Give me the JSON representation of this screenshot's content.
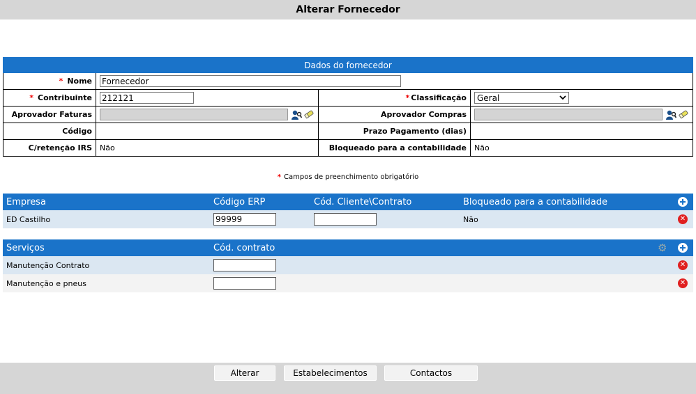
{
  "window": {
    "title": "Alterar Fornecedor"
  },
  "form": {
    "section_title": "Dados do fornecedor",
    "required_mark": "*",
    "nome": {
      "label": "Nome",
      "value": "Fornecedor"
    },
    "contribuinte": {
      "label": "Contribuinte",
      "value": "212121"
    },
    "classificacao": {
      "label": "Classificação",
      "value": "Geral"
    },
    "aprovador_faturas": {
      "label": "Aprovador Faturas",
      "value": ""
    },
    "aprovador_compras": {
      "label": "Aprovador Compras",
      "value": ""
    },
    "codigo": {
      "label": "Código",
      "value": ""
    },
    "prazo_pagamento": {
      "label": "Prazo Pagamento (dias)",
      "value": ""
    },
    "retencao_irs": {
      "label": "C/retenção IRS",
      "value": "Não"
    },
    "bloqueado": {
      "label": "Bloqueado para a contabilidade",
      "value": "Não"
    }
  },
  "required_note": "Campos de preenchimento obrigatório",
  "empresas": {
    "headers": [
      "Empresa",
      "Código ERP",
      "Cód. Cliente\\Contrato",
      "Bloqueado para a contabilidade"
    ],
    "rows": [
      {
        "empresa": "ED Castilho",
        "codigo_erp": "99999",
        "cod_cliente": "",
        "bloqueado": "Não"
      }
    ]
  },
  "servicos": {
    "headers": [
      "Serviços",
      "Cód. contrato"
    ],
    "rows": [
      {
        "servico": "Manutenção Contrato",
        "cod_contrato": ""
      },
      {
        "servico": "Manutenção e pneus",
        "cod_contrato": ""
      }
    ]
  },
  "footer": {
    "alterar": "Alterar",
    "estabelecimentos": "Estabelecimentos",
    "contactos": "Contactos"
  },
  "icons": {
    "add": "plus-circle-icon",
    "delete": "x-circle-icon",
    "settings": "gear-icon",
    "pick_user": "user-search-icon",
    "clear": "eraser-icon"
  },
  "colors": {
    "accent": "#1a73c9",
    "delete": "#e02020",
    "required": "#ee0000"
  }
}
